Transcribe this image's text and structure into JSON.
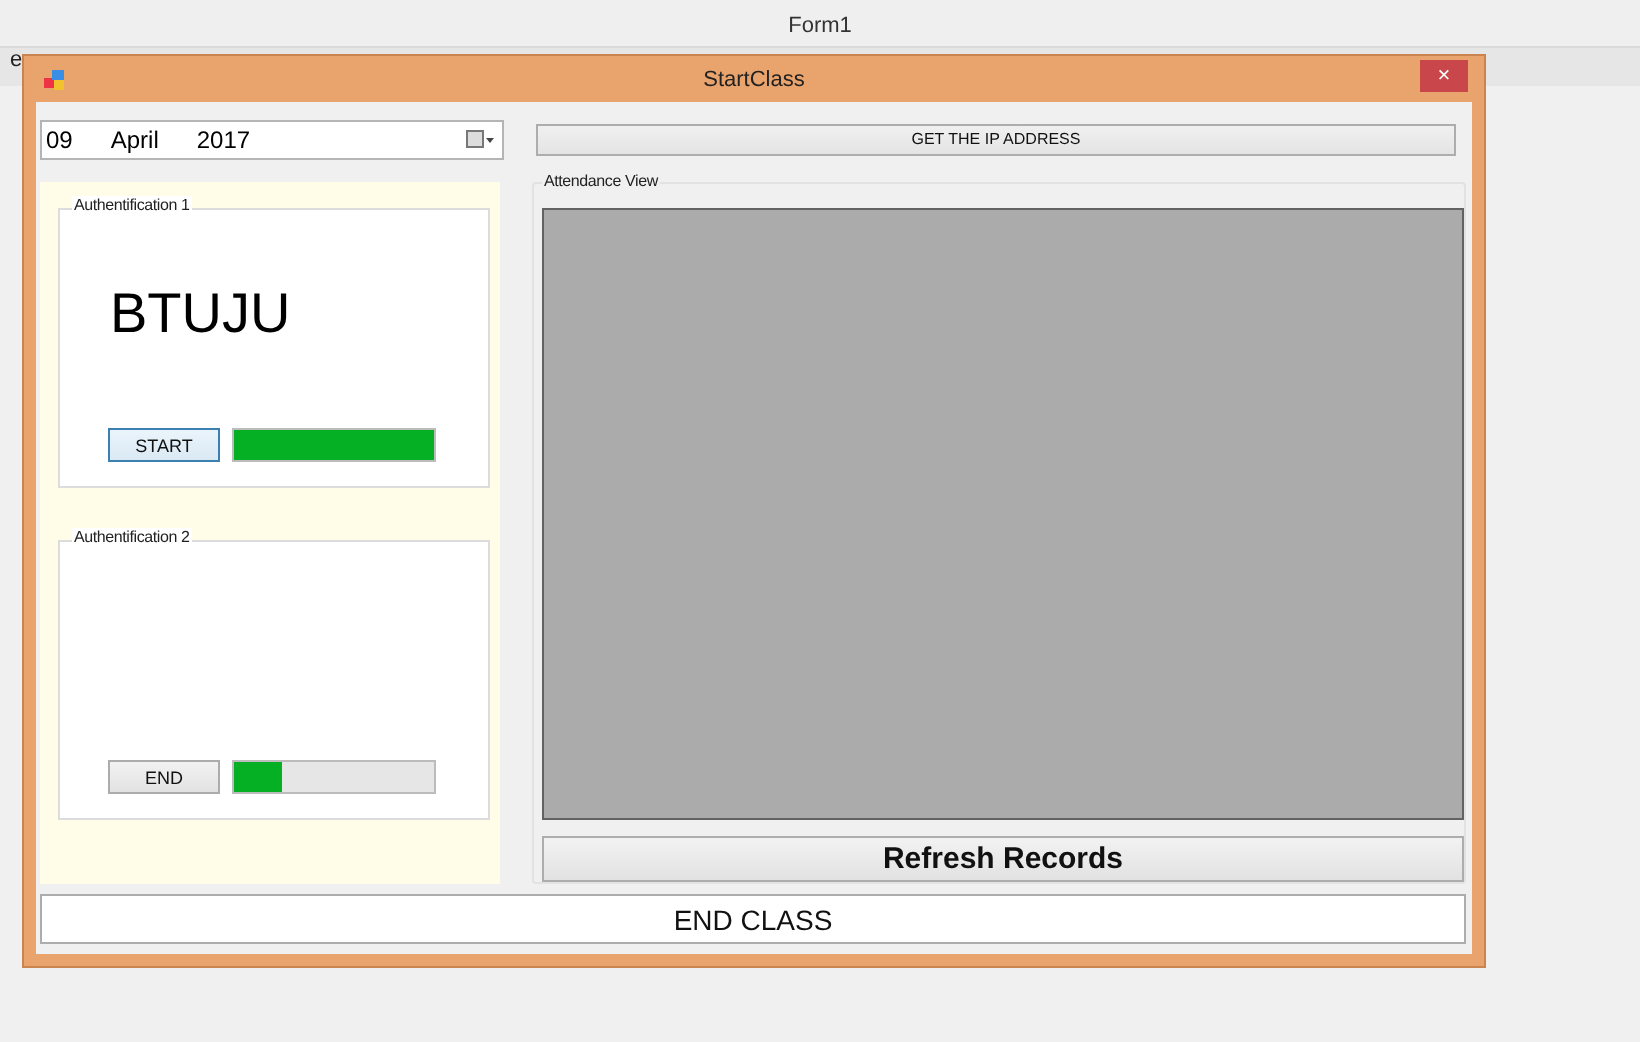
{
  "background_window": {
    "title": "Form1",
    "fragment": "e"
  },
  "window": {
    "title": "StartClass",
    "close": "×"
  },
  "date_picker": {
    "day": "09",
    "month": "April",
    "year": "2017"
  },
  "ip_button": "GET THE IP ADDRESS",
  "auth_groups": [
    {
      "title": "Authentification 1",
      "code": "BTUJU",
      "button": "START",
      "focused": true,
      "level": 1.0
    },
    {
      "title": "Authentification 2",
      "button": "END",
      "focused": false,
      "level": 0.24
    }
  ],
  "attendance": {
    "title": "Attendance View"
  },
  "refresh_button": "Refresh Records",
  "end_class_button": "END CLASS"
}
